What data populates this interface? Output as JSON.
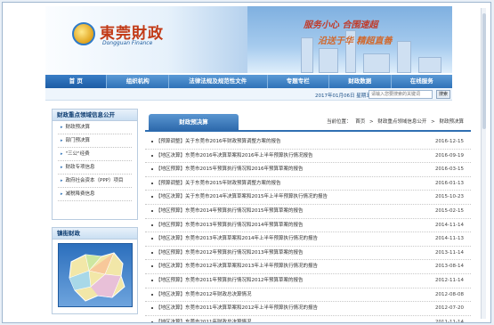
{
  "brand": {
    "logo_text": "東莞財政",
    "logo_sub": "Dongguan Finance",
    "slogan_line1": "服务小心 合围速超",
    "slogan_line2": "沿送于华 精超直善"
  },
  "nav": {
    "items": [
      "首 页",
      "组织机构",
      "法律法规及规范性文件",
      "专题专栏",
      "财政数据",
      "在线服务"
    ]
  },
  "datebar": {
    "date": "2017年01月06日 星期五",
    "search_placeholder": "请输入您要搜索的关键词",
    "search_button": "搜索"
  },
  "sidebar": {
    "title": "财政重点领域信息公开",
    "items": [
      "财政预决算",
      "部门预决算",
      "\"三公\"经费",
      "财政专项信息",
      "政府社会资本（PPP）项目",
      "减税降费信息"
    ],
    "map_title": "镇街财政"
  },
  "main": {
    "tab_title": "财政预决算",
    "breadcrumb": [
      "当前位置：",
      "首页",
      ">",
      "财政重点领域信息公开",
      ">",
      "财政预决算"
    ],
    "articles": [
      {
        "title": "【预算调整】关于东莞市2016年财政预算调整方案的报告",
        "date": "2016-12-15"
      },
      {
        "title": "【地区决算】东莞市2016年决算草案和2016年上半年预算执行情况报告",
        "date": "2016-09-19"
      },
      {
        "title": "【地区预算】东莞市2015年预算执行情况和2016年预算草案的报告",
        "date": "2016-03-15"
      },
      {
        "title": "【预算调整】关于东莞市2015年财政预算调整方案的报告",
        "date": "2016-01-13"
      },
      {
        "title": "【地区决算】关于东莞市2014年决算草案和2015年上半年预算执行情况的报告",
        "date": "2015-10-23"
      },
      {
        "title": "【地区预算】东莞市2014年预算执行情况和2015年预算草案的报告",
        "date": "2015-02-15"
      },
      {
        "title": "【地区预算】东莞市2013年预算执行情况和2014年预算草案的报告",
        "date": "2014-11-14"
      },
      {
        "title": "【地区决算】东莞市2013年决算草案和2014年上半年预算执行情况的报告",
        "date": "2014-11-13"
      },
      {
        "title": "【地区预算】东莞市2012年预算执行情况和2013年预算草案的报告",
        "date": "2013-11-14"
      },
      {
        "title": "【地区决算】东莞市2012年决算草案和2013年上半年预算执行情况的报告",
        "date": "2013-08-14"
      },
      {
        "title": "【地区预算】东莞市2011年预算执行情况和2012年预算草案的报告",
        "date": "2012-11-14"
      },
      {
        "title": "【地区决算】东莞市2012年财政总决算情况",
        "date": "2012-08-08"
      },
      {
        "title": "【地区决算】东莞市2011年决算草案和2012年上半年预算执行情况的报告",
        "date": "2012-07-20"
      },
      {
        "title": "【地区决算】东莞市2011年财政总决算情况",
        "date": "2011-11-14"
      }
    ]
  }
}
